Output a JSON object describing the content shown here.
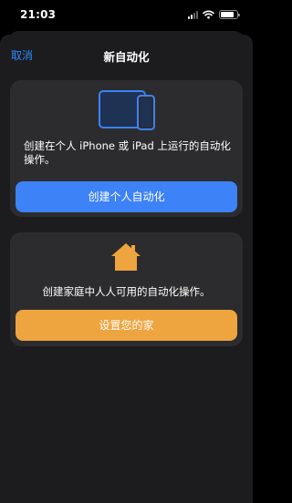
{
  "status_bar": {
    "time": "21:03"
  },
  "nav": {
    "cancel_label": "取消",
    "title": "新自动化"
  },
  "personal_card": {
    "description": "创建在个人 iPhone 或 iPad 上运行的自动化操作。",
    "button_label": "创建个人自动化",
    "icon": "iphone-ipad-icon"
  },
  "home_card": {
    "description": "创建家庭中人人可用的自动化操作。",
    "button_label": "设置您的家",
    "icon": "home-icon"
  },
  "colors": {
    "accent_blue": "#3d82f6",
    "accent_orange": "#eea43f",
    "link_blue": "#2f8bff",
    "card_bg": "#2c2c2e",
    "sheet_bg": "#1c1c1e"
  }
}
